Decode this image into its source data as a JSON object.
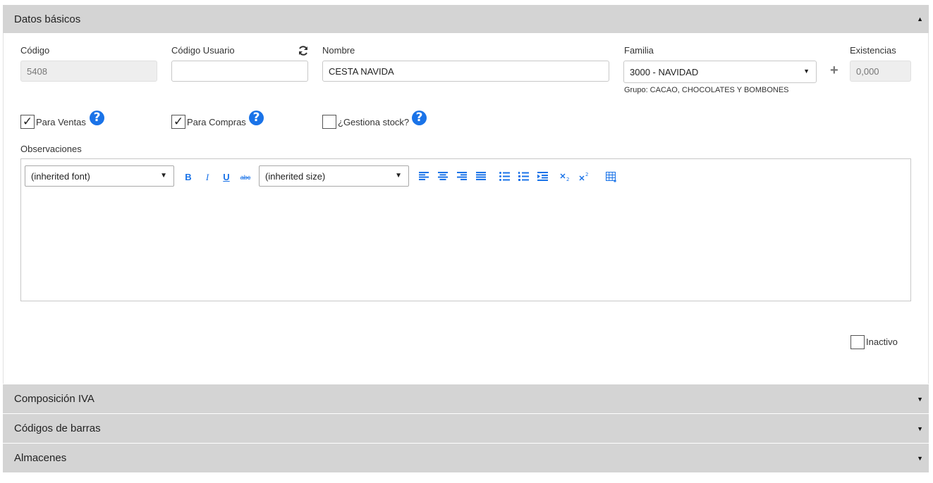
{
  "sections": {
    "datos_basicos": "Datos básicos",
    "composicion_iva": "Composición IVA",
    "codigos_barras": "Códigos de barras",
    "almacenes": "Almacenes"
  },
  "fields": {
    "codigo_label": "Código",
    "codigo_value": "5408",
    "codigo_usuario_label": "Código Usuario",
    "codigo_usuario_value": "",
    "nombre_label": "Nombre",
    "nombre_value": "CESTA NAVIDA",
    "familia_label": "Familia",
    "familia_value": "3000 - NAVIDAD",
    "grupo_text": "Grupo: CACAO, CHOCOLATES Y BOMBONES",
    "existencias_label": "Existencias",
    "existencias_value": "0,000"
  },
  "checkboxes": {
    "para_ventas": {
      "label": "Para Ventas",
      "checked": true
    },
    "para_compras": {
      "label": "Para Compras",
      "checked": true
    },
    "gestiona_stock": {
      "label": "¿Gestiona stock?",
      "checked": false
    },
    "inactivo": {
      "label": "Inactivo",
      "checked": false
    }
  },
  "observaciones": {
    "label": "Observaciones",
    "font_select": "(inherited font)",
    "size_select": "(inherited size)",
    "bold": "B",
    "italic": "I",
    "underline": "U",
    "strike": "abc",
    "content": ""
  },
  "icons": {
    "help": "?",
    "check": "✓",
    "plus": "+",
    "caret_up": "▲",
    "caret_down": "▼"
  },
  "colors": {
    "header_bg": "#d4d4d4",
    "accent": "#1a73e8",
    "disabled_bg": "#eeeeee"
  }
}
